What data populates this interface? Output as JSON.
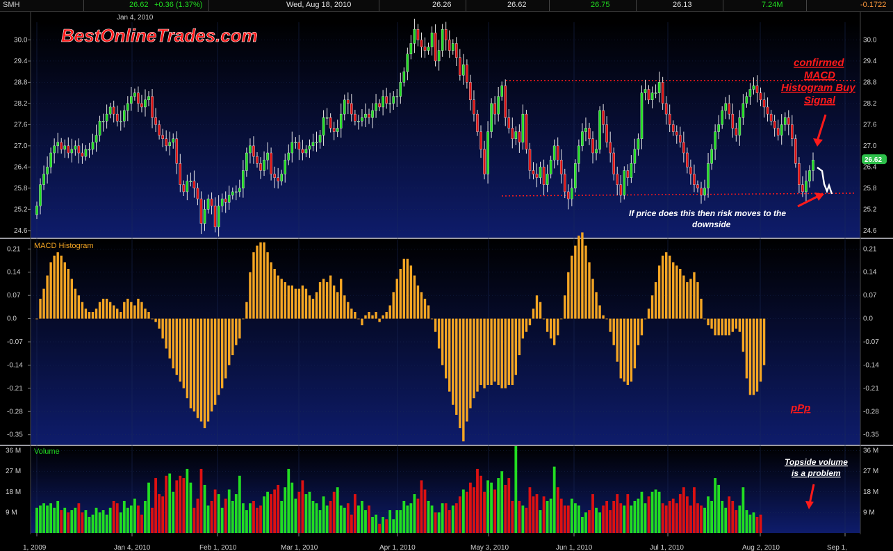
{
  "header": {
    "symbol": "SMH",
    "last": "26.62",
    "change": "+0.36 (1.37%)",
    "date": "Wed, Aug 18, 2010",
    "open": "26.26",
    "close": "26.62",
    "high": "26.75",
    "low": "26.13",
    "volume": "7.24M",
    "macd": "-0.1722"
  },
  "colors": {
    "up": "#22dd22",
    "down": "#dd1111",
    "histogram": "#f5a623",
    "annotation": "#ff1a1a",
    "price_tag": "#2dbf4a"
  },
  "annotations": {
    "brand": "BestOnlineTrades.com",
    "signal_line1": "confirmed",
    "signal_line2": "MACD",
    "signal_line3": "Histogram Buy",
    "signal_line4": "Signal",
    "risk_line1": "If price does this then risk moves to the",
    "risk_line2": "downside",
    "ppp": "pPp",
    "vol_line1": "Topside volume",
    "vol_line2": "is a problem",
    "date_marker": "Jan 4, 2010",
    "price_tag": "26.62"
  },
  "chart_data": [
    {
      "type": "candlestick",
      "title": "",
      "price_ticks": [
        "30.0",
        "29.4",
        "28.8",
        "28.2",
        "27.6",
        "27.0",
        "26.4",
        "25.8",
        "25.2",
        "24.6"
      ],
      "ylim": [
        24.4,
        30.5
      ],
      "support_line": 25.62,
      "resistance_line": 28.85,
      "closes": [
        25.3,
        25.9,
        26.2,
        26.4,
        26.8,
        27.0,
        27.1,
        26.9,
        27.0,
        26.8,
        26.9,
        27.0,
        26.8,
        26.7,
        26.9,
        26.9,
        27.1,
        27.3,
        27.7,
        27.7,
        27.9,
        28.1,
        27.9,
        27.7,
        27.7,
        28.0,
        28.2,
        28.4,
        28.5,
        28.2,
        28.1,
        28.3,
        28.4,
        27.8,
        27.6,
        27.3,
        27.2,
        27.0,
        27.1,
        27.2,
        26.5,
        25.9,
        25.7,
        26.0,
        26.0,
        25.8,
        25.5,
        24.8,
        25.2,
        25.5,
        25.3,
        24.7,
        25.3,
        25.5,
        25.4,
        25.6,
        25.7,
        25.7,
        25.8,
        26.3,
        26.8,
        27.0,
        26.7,
        26.5,
        26.3,
        26.6,
        26.8,
        26.2,
        26.1,
        26.0,
        26.2,
        26.6,
        26.8,
        27.1,
        27.1,
        26.9,
        26.8,
        26.9,
        27.0,
        27.1,
        27.1,
        27.3,
        27.8,
        27.8,
        27.5,
        27.4,
        27.5,
        27.9,
        28.3,
        28.2,
        27.9,
        27.7,
        27.7,
        27.8,
        27.9,
        27.8,
        28.0,
        28.2,
        28.1,
        28.4,
        28.2,
        28.2,
        28.4,
        28.4,
        28.8,
        29.1,
        29.6,
        29.9,
        30.3,
        30.0,
        29.8,
        29.7,
        29.8,
        30.2,
        29.4,
        29.7,
        30.3,
        30.0,
        29.7,
        29.9,
        29.5,
        29.0,
        29.3,
        28.8,
        28.3,
        27.9,
        27.4,
        26.9,
        26.2,
        27.4,
        28.2,
        27.9,
        28.4,
        28.7,
        27.8,
        27.5,
        27.2,
        27.4,
        27.1,
        27.9,
        26.9,
        26.3,
        26.2,
        26.1,
        26.4,
        25.9,
        26.2,
        26.6,
        27.0,
        26.6,
        26.2,
        25.7,
        25.5,
        25.8,
        26.5,
        27.0,
        27.4,
        27.5,
        27.2,
        26.8,
        26.9,
        28.0,
        27.6,
        27.1,
        26.8,
        26.2,
        25.9,
        25.6,
        26.3,
        26.1,
        26.5,
        26.9,
        27.2,
        28.5,
        28.6,
        28.3,
        28.5,
        28.5,
        28.8,
        28.2,
        27.9,
        27.6,
        27.4,
        27.3,
        27.1,
        26.8,
        26.4,
        26.2,
        25.9,
        25.8,
        25.6,
        25.8,
        26.5,
        26.9,
        27.4,
        27.6,
        28.0,
        28.2,
        27.9,
        27.5,
        27.3,
        27.8,
        28.2,
        28.4,
        28.6,
        28.7,
        28.5,
        28.3,
        28.1,
        27.9,
        27.7,
        27.5,
        27.3,
        27.6,
        27.8,
        27.6,
        27.2,
        26.5,
        25.9,
        25.7,
        26.0,
        26.3,
        26.6
      ]
    },
    {
      "type": "bar",
      "title": "MACD Histogram",
      "ticks": [
        "0.21",
        "0.14",
        "0.07",
        "0.0",
        "-0.07",
        "-0.14",
        "-0.21",
        "-0.28",
        "-0.35"
      ],
      "ylim": [
        -0.38,
        0.24
      ],
      "values": [
        0.0,
        0.06,
        0.09,
        0.13,
        0.17,
        0.19,
        0.2,
        0.19,
        0.17,
        0.15,
        0.12,
        0.09,
        0.07,
        0.05,
        0.03,
        0.02,
        0.02,
        0.03,
        0.05,
        0.06,
        0.06,
        0.05,
        0.04,
        0.03,
        0.02,
        0.05,
        0.06,
        0.05,
        0.04,
        0.06,
        0.05,
        0.03,
        0.02,
        0.0,
        -0.01,
        -0.03,
        -0.06,
        -0.09,
        -0.12,
        -0.15,
        -0.17,
        -0.19,
        -0.21,
        -0.24,
        -0.27,
        -0.28,
        -0.3,
        -0.31,
        -0.33,
        -0.31,
        -0.28,
        -0.26,
        -0.23,
        -0.21,
        -0.18,
        -0.14,
        -0.11,
        -0.08,
        -0.06,
        0.0,
        0.05,
        0.14,
        0.2,
        0.22,
        0.23,
        0.23,
        0.2,
        0.17,
        0.15,
        0.13,
        0.12,
        0.11,
        0.1,
        0.1,
        0.09,
        0.09,
        0.1,
        0.09,
        0.07,
        0.06,
        0.08,
        0.11,
        0.12,
        0.11,
        0.13,
        0.1,
        0.08,
        0.12,
        0.07,
        0.05,
        0.03,
        0.02,
        0.0,
        -0.02,
        0.01,
        0.02,
        0.01,
        0.02,
        -0.01,
        0.01,
        0.02,
        0.04,
        0.08,
        0.12,
        0.15,
        0.18,
        0.18,
        0.16,
        0.13,
        0.1,
        0.08,
        0.06,
        0.04,
        0.0,
        -0.04,
        -0.09,
        -0.14,
        -0.18,
        -0.22,
        -0.26,
        -0.29,
        -0.33,
        -0.37,
        -0.31,
        -0.27,
        -0.24,
        -0.22,
        -0.2,
        -0.21,
        -0.2,
        -0.2,
        -0.19,
        -0.2,
        -0.21,
        -0.21,
        -0.2,
        -0.2,
        -0.17,
        -0.11,
        -0.06,
        -0.04,
        -0.02,
        0.03,
        0.07,
        0.05,
        0.0,
        -0.04,
        -0.06,
        -0.08,
        -0.05,
        0.0,
        0.07,
        0.14,
        0.19,
        0.22,
        0.25,
        0.26,
        0.22,
        0.17,
        0.12,
        0.08,
        0.04,
        0.01,
        0.0,
        -0.04,
        -0.08,
        -0.13,
        -0.18,
        -0.19,
        -0.2,
        -0.19,
        -0.15,
        -0.08,
        -0.05,
        0.0,
        0.03,
        0.07,
        0.11,
        0.16,
        0.19,
        0.2,
        0.19,
        0.17,
        0.16,
        0.15,
        0.13,
        0.11,
        0.12,
        0.14,
        0.11,
        0.06,
        0.0,
        -0.02,
        -0.03,
        -0.05,
        -0.05,
        -0.05,
        -0.05,
        -0.05,
        -0.04,
        -0.03,
        -0.04,
        -0.1,
        -0.18,
        -0.23,
        -0.23,
        -0.22,
        -0.19,
        -0.14
      ]
    },
    {
      "type": "bar",
      "title": "Volume",
      "ticks": [
        "36 M",
        "27 M",
        "18 M",
        "9 M"
      ],
      "ylim": [
        0,
        38
      ],
      "values": [
        11,
        12,
        13,
        12,
        13,
        11,
        14,
        10,
        11,
        9,
        10,
        11,
        13,
        9,
        10,
        7,
        8,
        11,
        9,
        10,
        8,
        11,
        14,
        13,
        9,
        14,
        11,
        12,
        15,
        12,
        8,
        14,
        22,
        11,
        24,
        17,
        16,
        25,
        26,
        18,
        23,
        25,
        24,
        28,
        22,
        11,
        15,
        28,
        21,
        12,
        14,
        19,
        17,
        11,
        15,
        19,
        14,
        17,
        25,
        13,
        10,
        13,
        14,
        11,
        12,
        16,
        18,
        17,
        19,
        21,
        14,
        20,
        28,
        22,
        15,
        18,
        23,
        17,
        18,
        14,
        13,
        10,
        16,
        12,
        14,
        18,
        20,
        12,
        11,
        13,
        8,
        17,
        12,
        14,
        10,
        12,
        7,
        8,
        4,
        7,
        6,
        10,
        6,
        10,
        10,
        14,
        12,
        13,
        17,
        15,
        23,
        19,
        14,
        12,
        9,
        9,
        13,
        13,
        10,
        12,
        13,
        16,
        19,
        18,
        22,
        20,
        28,
        25,
        18,
        23,
        22,
        19,
        24,
        27,
        21,
        24,
        14,
        38,
        14,
        12,
        11,
        20,
        16,
        17,
        10,
        16,
        14,
        15,
        29,
        20,
        15,
        12,
        12,
        15,
        13,
        12,
        7,
        9,
        10,
        17,
        11,
        9,
        12,
        14,
        10,
        14,
        17,
        13,
        12,
        17,
        12,
        14,
        15,
        18,
        13,
        16,
        18,
        19,
        18,
        13,
        12,
        14,
        15,
        13,
        17,
        20,
        16,
        12,
        20,
        13,
        12,
        11,
        16,
        14,
        24,
        21,
        14,
        11,
        16,
        14,
        10,
        12,
        20,
        10,
        8,
        9,
        7,
        8
      ]
    }
  ],
  "x_axis": {
    "labels": [
      "1, 2009",
      "Jan 4, 2010",
      "Feb 1, 2010",
      "Mar 1, 2010",
      "Apr 1, 2010",
      "May 3, 2010",
      "Jun 1, 2010",
      "Jul 1, 2010",
      "Aug 2, 2010",
      "Sep 1,"
    ]
  }
}
